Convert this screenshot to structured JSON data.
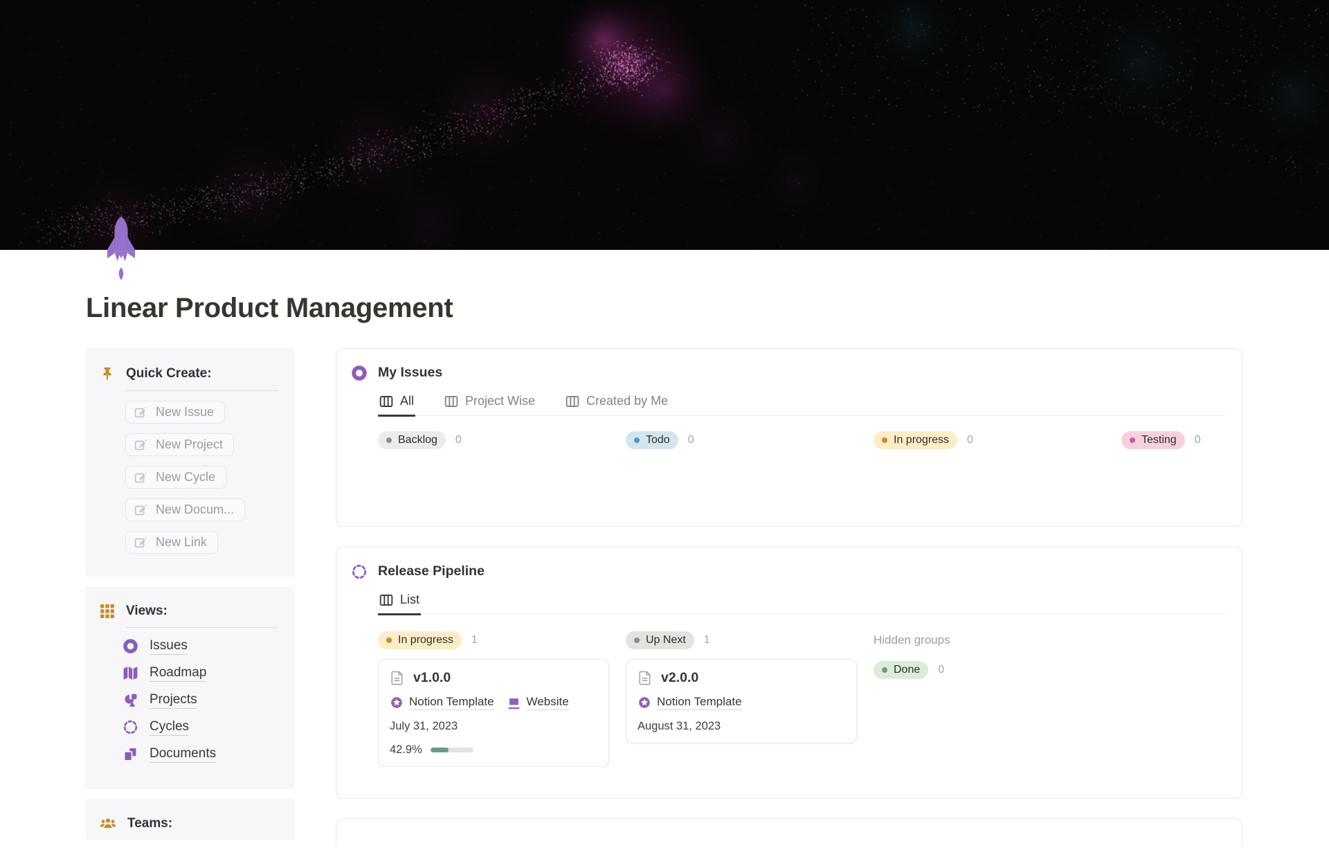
{
  "page": {
    "title": "Linear Product Management",
    "icon": "rocket-icon"
  },
  "colors": {
    "accent_purple": "#9065b0",
    "icon_gold": "#c48f2c",
    "progress_fill": "#6b9a88"
  },
  "sidebar": {
    "quick_create": {
      "title": "Quick Create:",
      "buttons": [
        {
          "label": "New Issue"
        },
        {
          "label": "New Project"
        },
        {
          "label": "New Cycle"
        },
        {
          "label": "New Docum..."
        },
        {
          "label": "New Link"
        }
      ]
    },
    "views": {
      "title": "Views:",
      "items": [
        {
          "label": "Issues",
          "icon": "issues-icon"
        },
        {
          "label": "Roadmap",
          "icon": "roadmap-icon"
        },
        {
          "label": "Projects",
          "icon": "projects-icon"
        },
        {
          "label": "Cycles",
          "icon": "cycles-icon"
        },
        {
          "label": "Documents",
          "icon": "documents-icon"
        }
      ]
    },
    "teams": {
      "title": "Teams:"
    }
  },
  "main": {
    "my_issues": {
      "title": "My Issues",
      "tabs": [
        {
          "label": "All",
          "active": true
        },
        {
          "label": "Project Wise",
          "active": false
        },
        {
          "label": "Created by Me",
          "active": false
        }
      ],
      "groups": [
        {
          "label": "Backlog",
          "count": "0",
          "bg": "#ececea",
          "dot": "#8f8e8b"
        },
        {
          "label": "Todo",
          "count": "0",
          "bg": "#d3e5ef",
          "dot": "#5b97bd"
        },
        {
          "label": "In progress",
          "count": "0",
          "bg": "#fdecc8",
          "dot": "#c88b2e"
        },
        {
          "label": "Testing",
          "count": "0",
          "bg": "#f5d1de",
          "dot": "#cf5b94"
        }
      ]
    },
    "release_pipeline": {
      "title": "Release Pipeline",
      "tabs": [
        {
          "label": "List",
          "active": true
        }
      ],
      "hidden_groups_label": "Hidden groups",
      "columns": [
        {
          "pill": {
            "label": "In progress",
            "count": "1",
            "bg": "#fdecc8",
            "dot": "#c88b2e"
          },
          "card": {
            "title": "v1.0.0",
            "links": [
              {
                "label": "Notion Template",
                "icon": "star-badge-icon"
              },
              {
                "label": "Website",
                "icon": "laptop-icon"
              }
            ],
            "date": "July 31, 2023",
            "progress_label": "42.9%"
          }
        },
        {
          "pill": {
            "label": "Up Next",
            "count": "1",
            "bg": "#e3e2e0",
            "dot": "#8f8e8b"
          },
          "card": {
            "title": "v2.0.0",
            "links": [
              {
                "label": "Notion Template",
                "icon": "star-badge-icon"
              }
            ],
            "date": "August 31, 2023"
          }
        },
        {
          "pill": {
            "label": "Done",
            "count": "0",
            "bg": "#dcecdb",
            "dot": "#6c9b7d"
          }
        }
      ]
    }
  }
}
